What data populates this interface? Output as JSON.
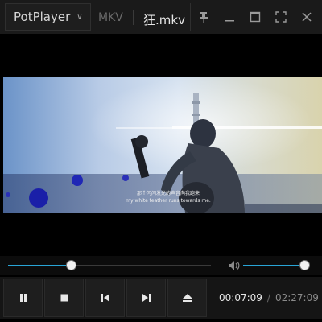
{
  "app": {
    "name": "PotPlayer",
    "format": "MKV",
    "file_name": "狂.mkv"
  },
  "window_controls": [
    {
      "name": "pin-icon"
    },
    {
      "name": "minimize-icon"
    },
    {
      "name": "maximize-icon"
    },
    {
      "name": "fullscreen-icon"
    },
    {
      "name": "close-icon"
    }
  ],
  "video": {
    "subtitle_line1": "那个闪闪发光的声音向我跑来",
    "subtitle_line2": "my white feather runs towards me.",
    "colors": {
      "sky_left": "#5f8fcb",
      "sky_mid": "#c9d8ef",
      "sky_right": "#ddd5b5"
    }
  },
  "playback": {
    "progress": 0.3127,
    "volume": 0.93,
    "current_time": "00:07:09",
    "separator": "/",
    "total_time": "02:27:09"
  },
  "controls": [
    {
      "name": "pause-button",
      "icon": "pause-icon"
    },
    {
      "name": "stop-button",
      "icon": "stop-icon"
    },
    {
      "name": "previous-button",
      "icon": "previous-icon"
    },
    {
      "name": "next-button",
      "icon": "next-icon"
    },
    {
      "name": "eject-button",
      "icon": "eject-icon"
    }
  ],
  "accent_color": "#29a5d6"
}
